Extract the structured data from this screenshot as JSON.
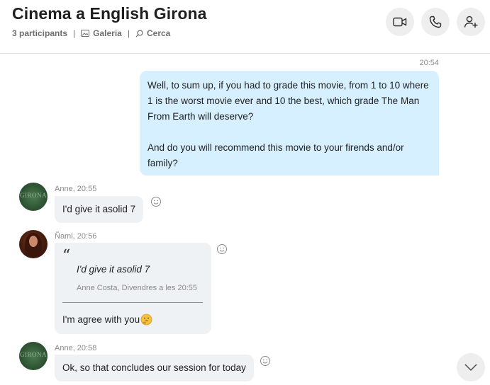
{
  "header": {
    "title": "Cinema a English Girona",
    "participants": "3 participants",
    "separator": "|",
    "gallery_label": "Galeria",
    "search_label": "Cerca",
    "video_call_icon": "video-camera-icon",
    "audio_call_icon": "phone-icon",
    "add_person_icon": "add-person-icon"
  },
  "messages": [
    {
      "direction": "outgoing",
      "time": "20:54",
      "paragraphs": [
        "Well, to sum up, if you had to grade this movie, from 1 to 10 where 1 is the worst movie ever and 10 the best, which grade The Man From Earth will deserve?",
        "And do you will recommend this movie to your firends and/or family?"
      ]
    },
    {
      "direction": "incoming",
      "meta": "Anne, 20:55",
      "text": "I'd give it asolid 7"
    },
    {
      "direction": "incoming",
      "meta": "Ñami, 20:56",
      "quote": {
        "mark": "“",
        "text": "I'd give it asolid 7",
        "source": "Anne Costa, Divendres a les 20:55"
      },
      "text": "I'm agree with you",
      "emoji": "thinking-face-icon"
    },
    {
      "direction": "incoming",
      "meta": "Anne, 20:58",
      "text": "Ok, so that concludes our session for today"
    }
  ],
  "colors": {
    "outgoing_bubble": "#d6f0ff",
    "incoming_bubble": "#eff2f5",
    "button_bg": "#eeeeee",
    "text_muted": "#8a8a8a"
  }
}
